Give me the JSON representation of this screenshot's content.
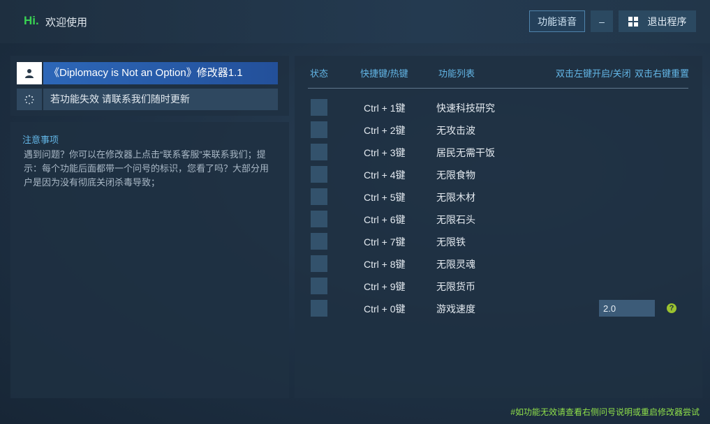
{
  "header": {
    "hi": "Hi.",
    "welcome": "欢迎使用",
    "voice_btn": "功能语音",
    "min_btn": "–",
    "exit_btn": "退出程序"
  },
  "left": {
    "title": "《Diplomacy is Not an Option》修改器1.1",
    "notice_line": "若功能失效  请联系我们随时更新",
    "notes_title": "注意事项",
    "notes_body": "遇到问题？你可以在修改器上点击“联系客服”来联系我们；提示：每个功能后面都带一个问号的标识，您看了吗？大部分用户是因为没有彻底关闭杀毒导致；"
  },
  "table": {
    "col_status": "状态",
    "col_hotkey": "快捷键/热键",
    "col_features": "功能列表",
    "hint_left": "双击左键开启/关闭",
    "hint_right": "双击右键重置",
    "rows": [
      {
        "key": "Ctrl + 1键",
        "name": "快速科技研究"
      },
      {
        "key": "Ctrl + 2键",
        "name": "无攻击波"
      },
      {
        "key": "Ctrl + 3键",
        "name": "居民无需干饭"
      },
      {
        "key": "Ctrl + 4键",
        "name": "无限食物"
      },
      {
        "key": "Ctrl + 5键",
        "name": "无限木材"
      },
      {
        "key": "Ctrl + 6键",
        "name": "无限石头"
      },
      {
        "key": "Ctrl + 7键",
        "name": "无限铁"
      },
      {
        "key": "Ctrl + 8键",
        "name": "无限灵魂"
      },
      {
        "key": "Ctrl + 9键",
        "name": "无限货币"
      },
      {
        "key": "Ctrl + 0键",
        "name": "游戏速度"
      }
    ],
    "speed_value": "2.0",
    "help_symbol": "?"
  },
  "footer": "#如功能无效请查看右侧问号说明或重启修改器尝试",
  "colors": {
    "accent": "#63b6e6",
    "hi_green": "#39d353",
    "title_blue": "#2d67b8",
    "footer_green": "#8fe04a"
  }
}
